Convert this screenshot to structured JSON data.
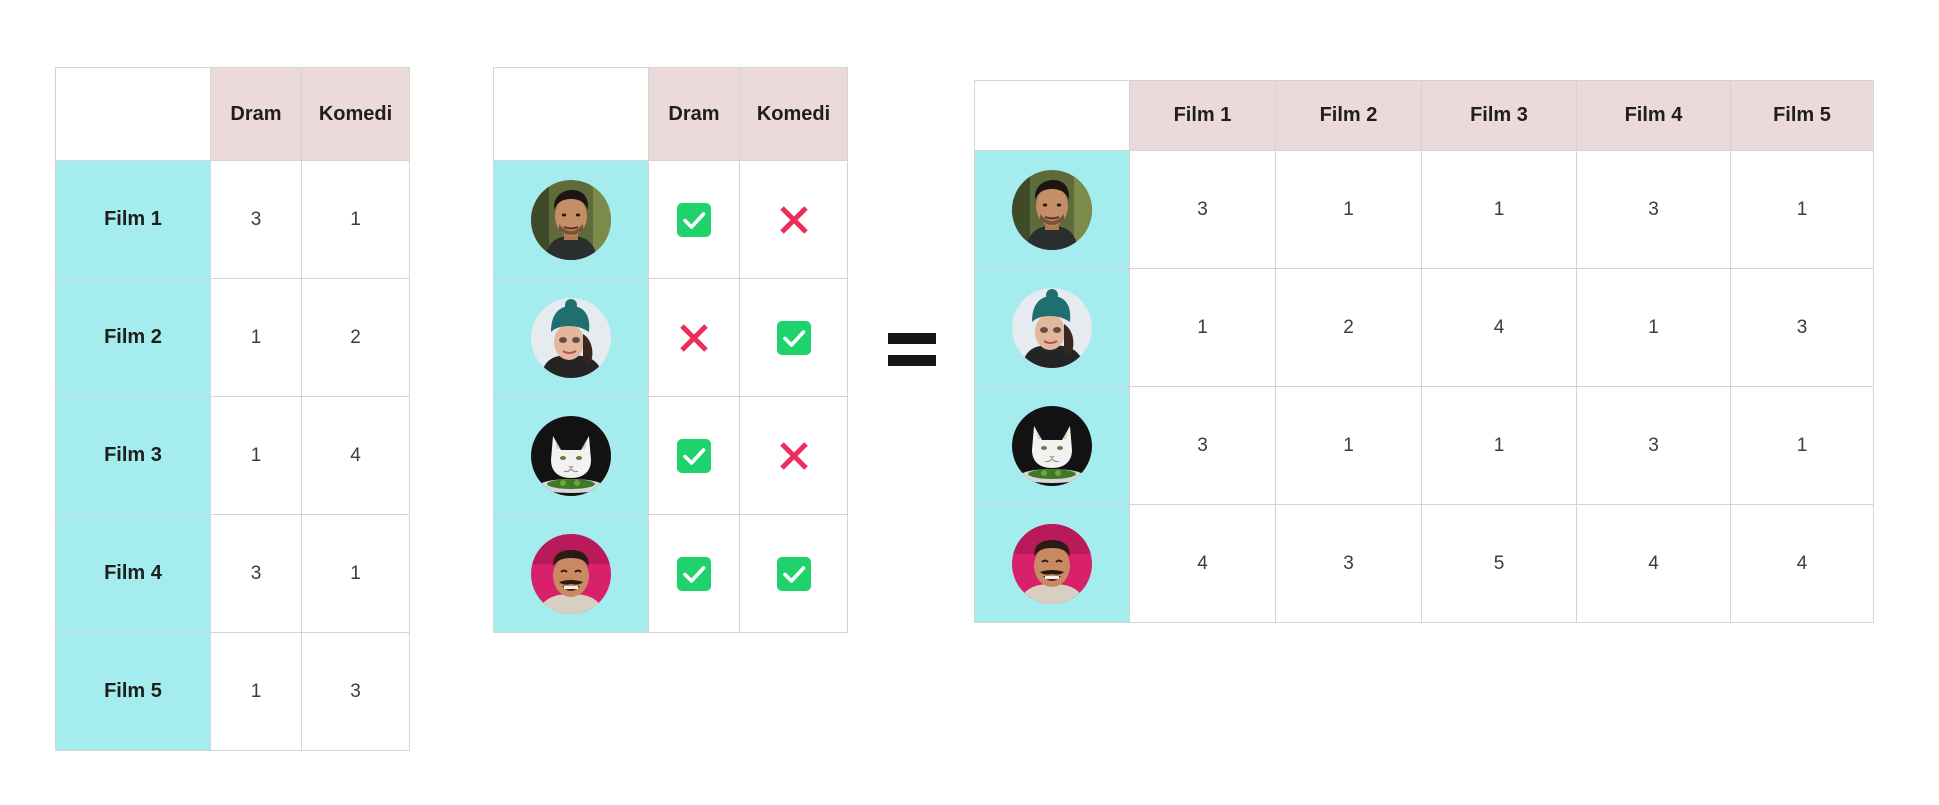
{
  "table_ratings": {
    "columns": [
      "Dram",
      "Komedi"
    ],
    "rows": [
      {
        "label": "Film 1",
        "values": [
          "3",
          "1"
        ]
      },
      {
        "label": "Film 2",
        "values": [
          "1",
          "2"
        ]
      },
      {
        "label": "Film 3",
        "values": [
          "1",
          "4"
        ]
      },
      {
        "label": "Film 4",
        "values": [
          "3",
          "1"
        ]
      },
      {
        "label": "Film 5",
        "values": [
          "1",
          "3"
        ]
      }
    ]
  },
  "table_preferences": {
    "columns": [
      "Dram",
      "Komedi"
    ],
    "rows": [
      {
        "avatar": "man-avatar",
        "values": [
          "check",
          "cross"
        ]
      },
      {
        "avatar": "woman-beanie-avatar",
        "values": [
          "cross",
          "check"
        ]
      },
      {
        "avatar": "cat-avatar",
        "values": [
          "check",
          "cross"
        ]
      },
      {
        "avatar": "laughing-man-avatar",
        "values": [
          "check",
          "check"
        ]
      }
    ]
  },
  "table_result": {
    "columns": [
      "Film 1",
      "Film 2",
      "Film 3",
      "Film 4",
      "Film 5"
    ],
    "rows": [
      {
        "avatar": "man-avatar",
        "values": [
          "3",
          "1",
          "1",
          "3",
          "1"
        ]
      },
      {
        "avatar": "woman-beanie-avatar",
        "values": [
          "1",
          "2",
          "4",
          "1",
          "3"
        ]
      },
      {
        "avatar": "cat-avatar",
        "values": [
          "3",
          "1",
          "1",
          "3",
          "1"
        ]
      },
      {
        "avatar": "laughing-man-avatar",
        "values": [
          "4",
          "3",
          "5",
          "4",
          "4"
        ]
      }
    ]
  },
  "operator": "equals-sign",
  "colors": {
    "column_header": "#ecdadb",
    "row_header": "#a5ecee",
    "check": "#1ed36b",
    "cross": "#ec2d5c",
    "border": "#d4d4d4"
  }
}
